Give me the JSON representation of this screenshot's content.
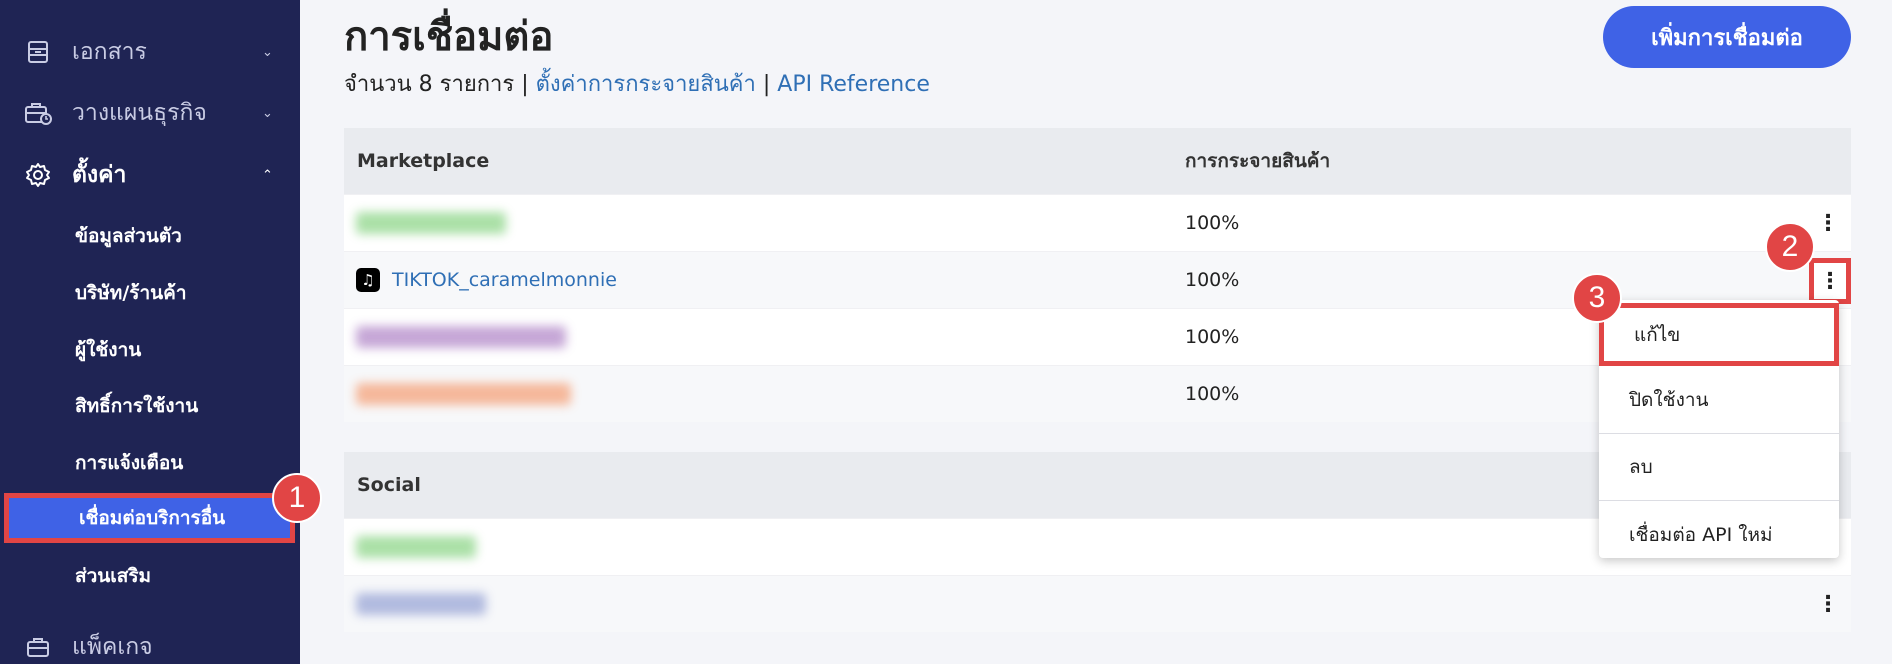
{
  "sidebar": {
    "items": [
      {
        "label": "เอกสาร",
        "icon": "archive-icon",
        "expanded": false
      },
      {
        "label": "วางแผนธุรกิจ",
        "icon": "briefcase-clock-icon",
        "expanded": false
      },
      {
        "label": "ตั้งค่า",
        "icon": "gear-icon",
        "expanded": true
      },
      {
        "label": "แพ็คเกจ",
        "icon": "briefcase-icon",
        "expanded": false
      }
    ],
    "sub_items": [
      {
        "label": "ข้อมูลส่วนตัว"
      },
      {
        "label": "บริษัท/ร้านค้า"
      },
      {
        "label": "ผู้ใช้งาน"
      },
      {
        "label": "สิทธิ์การใช้งาน"
      },
      {
        "label": "การแจ้งเตือน"
      },
      {
        "label": "เชื่อมต่อบริการอื่น",
        "active": true
      },
      {
        "label": "ส่วนเสริม"
      }
    ]
  },
  "page": {
    "title": "การเชื่อมต่อ",
    "count_text": "จำนวน 8 รายการ",
    "separator": "|",
    "link_distribution": "ตั้งค่าการกระจายสินค้า",
    "link_api": "API Reference",
    "add_button": "เพิ่มการเชื่อมต่อ"
  },
  "marketplace": {
    "header_col1": "Marketplace",
    "header_col2": "การกระจายสินค้า",
    "rows": [
      {
        "name": "",
        "distribution": "100%",
        "blur_color": "#8fd68a"
      },
      {
        "name": "TIKTOK_caramelmonnie",
        "distribution": "100%",
        "icon": "tiktok-icon"
      },
      {
        "name": "",
        "distribution": "100%",
        "blur_color": "#b38ac9"
      },
      {
        "name": "",
        "distribution": "100%",
        "blur_color": "#f5a27a"
      }
    ]
  },
  "social": {
    "header_col1": "Social",
    "rows": [
      {
        "name": "",
        "blur_color": "#8fd68a"
      },
      {
        "name": "",
        "blur_color": "#9aa6d6"
      }
    ]
  },
  "context_menu": {
    "items": [
      "แก้ไข",
      "ปิดใช้งาน",
      "ลบ",
      "เชื่อมต่อ API ใหม่"
    ]
  },
  "annotations": [
    "1",
    "2",
    "3"
  ],
  "colors": {
    "sidebar_bg": "#1f2454",
    "accent": "#3f62e6",
    "highlight": "#e14545",
    "link": "#2f6fb5"
  }
}
